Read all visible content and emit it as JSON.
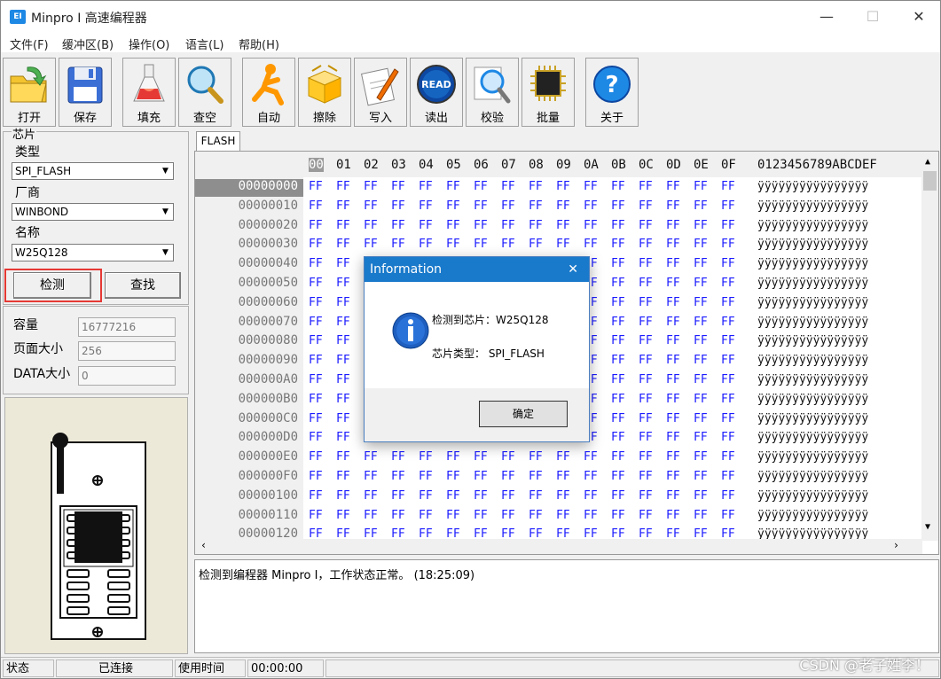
{
  "window": {
    "title": "Minpro I 高速编程器",
    "app_icon": "EI",
    "min": "—",
    "max": "☐",
    "close": "✕"
  },
  "menu": [
    "文件(F)",
    "缓冲区(B)",
    "操作(O)",
    "语言(L)",
    "帮助(H)"
  ],
  "toolbar": [
    {
      "label": "打开",
      "icon": "open-folder-icon"
    },
    {
      "label": "保存",
      "icon": "save-disk-icon"
    },
    {
      "label": "填充",
      "icon": "flask-fill-icon"
    },
    {
      "label": "查空",
      "icon": "magnifier-blank-icon"
    },
    {
      "label": "自动",
      "icon": "auto-runner-icon"
    },
    {
      "label": "擦除",
      "icon": "erase-box-icon"
    },
    {
      "label": "写入",
      "icon": "write-pen-icon"
    },
    {
      "label": "读出",
      "icon": "read-icon"
    },
    {
      "label": "校验",
      "icon": "verify-magnifier-icon"
    },
    {
      "label": "批量",
      "icon": "batch-chip-icon"
    },
    {
      "label": "关于",
      "icon": "help-question-icon"
    }
  ],
  "read_icon_text": "READ",
  "chip": {
    "legend": "芯片",
    "type_label": "类型",
    "type_value": "SPI_FLASH",
    "vendor_label": "厂商",
    "vendor_value": "WINBOND",
    "name_label": "名称",
    "name_value": "W25Q128",
    "detect_button": "检测",
    "find_button": "查找"
  },
  "info": {
    "capacity_label": "容量",
    "capacity_value": "16777216",
    "page_label": "页面大小",
    "page_value": "256",
    "data_label": "DATA大小",
    "data_value": "0"
  },
  "tab": "FLASH",
  "hex": {
    "columns": [
      "00",
      "01",
      "02",
      "03",
      "04",
      "05",
      "06",
      "07",
      "08",
      "09",
      "0A",
      "0B",
      "0C",
      "0D",
      "0E",
      "0F"
    ],
    "ascii_header": "0123456789ABCDEF",
    "addresses": [
      "00000000",
      "00000010",
      "00000020",
      "00000030",
      "00000040",
      "00000050",
      "00000060",
      "00000070",
      "00000080",
      "00000090",
      "000000A0",
      "000000B0",
      "000000C0",
      "000000D0",
      "000000E0",
      "000000F0",
      "00000100",
      "00000110",
      "00000120"
    ],
    "byte": "FF",
    "ascii_row": "ÿÿÿÿÿÿÿÿÿÿÿÿÿÿÿÿ"
  },
  "log": "检测到编程器 Minpro I，工作状态正常。 (18:25:09)",
  "status": {
    "label": "状态",
    "connection": "已连接",
    "time_label": "使用时间",
    "time_value": "00:00:00"
  },
  "watermark": "CSDN @老子姓李！",
  "dialog": {
    "title": "Information",
    "close": "✕",
    "line1": "检测到芯片：W25Q128",
    "line2": "芯片类型：  SPI_FLASH",
    "ok": "确定"
  }
}
